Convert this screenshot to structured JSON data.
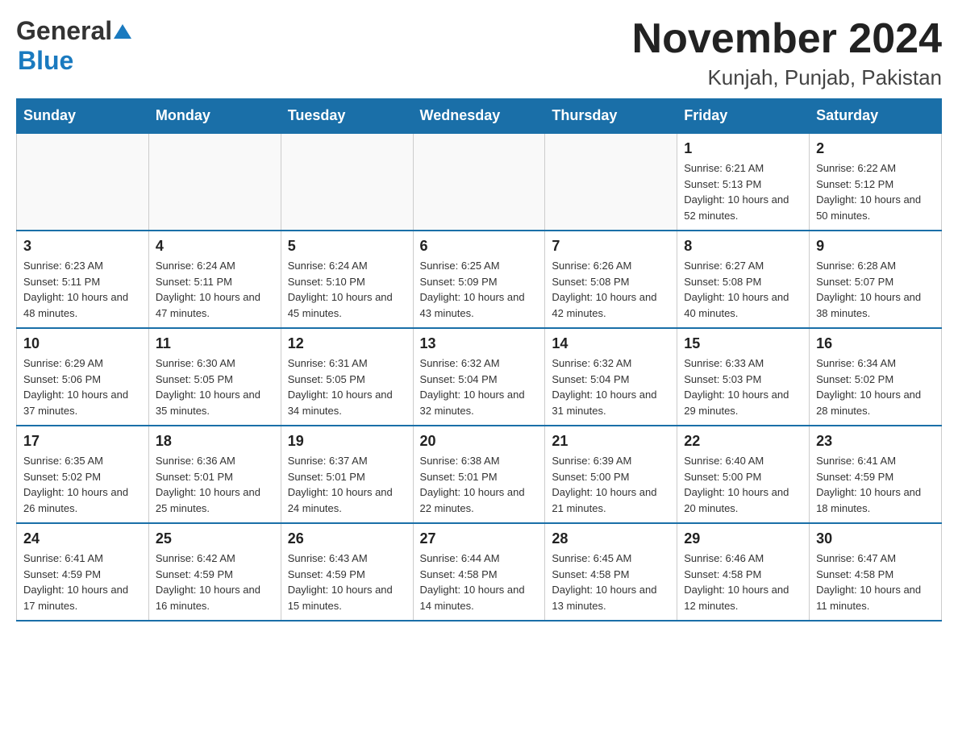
{
  "header": {
    "month_year": "November 2024",
    "location": "Kunjah, Punjab, Pakistan",
    "logo_general": "General",
    "logo_blue": "Blue"
  },
  "weekdays": [
    "Sunday",
    "Monday",
    "Tuesday",
    "Wednesday",
    "Thursday",
    "Friday",
    "Saturday"
  ],
  "weeks": [
    [
      {
        "day": "",
        "info": ""
      },
      {
        "day": "",
        "info": ""
      },
      {
        "day": "",
        "info": ""
      },
      {
        "day": "",
        "info": ""
      },
      {
        "day": "",
        "info": ""
      },
      {
        "day": "1",
        "info": "Sunrise: 6:21 AM\nSunset: 5:13 PM\nDaylight: 10 hours and 52 minutes."
      },
      {
        "day": "2",
        "info": "Sunrise: 6:22 AM\nSunset: 5:12 PM\nDaylight: 10 hours and 50 minutes."
      }
    ],
    [
      {
        "day": "3",
        "info": "Sunrise: 6:23 AM\nSunset: 5:11 PM\nDaylight: 10 hours and 48 minutes."
      },
      {
        "day": "4",
        "info": "Sunrise: 6:24 AM\nSunset: 5:11 PM\nDaylight: 10 hours and 47 minutes."
      },
      {
        "day": "5",
        "info": "Sunrise: 6:24 AM\nSunset: 5:10 PM\nDaylight: 10 hours and 45 minutes."
      },
      {
        "day": "6",
        "info": "Sunrise: 6:25 AM\nSunset: 5:09 PM\nDaylight: 10 hours and 43 minutes."
      },
      {
        "day": "7",
        "info": "Sunrise: 6:26 AM\nSunset: 5:08 PM\nDaylight: 10 hours and 42 minutes."
      },
      {
        "day": "8",
        "info": "Sunrise: 6:27 AM\nSunset: 5:08 PM\nDaylight: 10 hours and 40 minutes."
      },
      {
        "day": "9",
        "info": "Sunrise: 6:28 AM\nSunset: 5:07 PM\nDaylight: 10 hours and 38 minutes."
      }
    ],
    [
      {
        "day": "10",
        "info": "Sunrise: 6:29 AM\nSunset: 5:06 PM\nDaylight: 10 hours and 37 minutes."
      },
      {
        "day": "11",
        "info": "Sunrise: 6:30 AM\nSunset: 5:05 PM\nDaylight: 10 hours and 35 minutes."
      },
      {
        "day": "12",
        "info": "Sunrise: 6:31 AM\nSunset: 5:05 PM\nDaylight: 10 hours and 34 minutes."
      },
      {
        "day": "13",
        "info": "Sunrise: 6:32 AM\nSunset: 5:04 PM\nDaylight: 10 hours and 32 minutes."
      },
      {
        "day": "14",
        "info": "Sunrise: 6:32 AM\nSunset: 5:04 PM\nDaylight: 10 hours and 31 minutes."
      },
      {
        "day": "15",
        "info": "Sunrise: 6:33 AM\nSunset: 5:03 PM\nDaylight: 10 hours and 29 minutes."
      },
      {
        "day": "16",
        "info": "Sunrise: 6:34 AM\nSunset: 5:02 PM\nDaylight: 10 hours and 28 minutes."
      }
    ],
    [
      {
        "day": "17",
        "info": "Sunrise: 6:35 AM\nSunset: 5:02 PM\nDaylight: 10 hours and 26 minutes."
      },
      {
        "day": "18",
        "info": "Sunrise: 6:36 AM\nSunset: 5:01 PM\nDaylight: 10 hours and 25 minutes."
      },
      {
        "day": "19",
        "info": "Sunrise: 6:37 AM\nSunset: 5:01 PM\nDaylight: 10 hours and 24 minutes."
      },
      {
        "day": "20",
        "info": "Sunrise: 6:38 AM\nSunset: 5:01 PM\nDaylight: 10 hours and 22 minutes."
      },
      {
        "day": "21",
        "info": "Sunrise: 6:39 AM\nSunset: 5:00 PM\nDaylight: 10 hours and 21 minutes."
      },
      {
        "day": "22",
        "info": "Sunrise: 6:40 AM\nSunset: 5:00 PM\nDaylight: 10 hours and 20 minutes."
      },
      {
        "day": "23",
        "info": "Sunrise: 6:41 AM\nSunset: 4:59 PM\nDaylight: 10 hours and 18 minutes."
      }
    ],
    [
      {
        "day": "24",
        "info": "Sunrise: 6:41 AM\nSunset: 4:59 PM\nDaylight: 10 hours and 17 minutes."
      },
      {
        "day": "25",
        "info": "Sunrise: 6:42 AM\nSunset: 4:59 PM\nDaylight: 10 hours and 16 minutes."
      },
      {
        "day": "26",
        "info": "Sunrise: 6:43 AM\nSunset: 4:59 PM\nDaylight: 10 hours and 15 minutes."
      },
      {
        "day": "27",
        "info": "Sunrise: 6:44 AM\nSunset: 4:58 PM\nDaylight: 10 hours and 14 minutes."
      },
      {
        "day": "28",
        "info": "Sunrise: 6:45 AM\nSunset: 4:58 PM\nDaylight: 10 hours and 13 minutes."
      },
      {
        "day": "29",
        "info": "Sunrise: 6:46 AM\nSunset: 4:58 PM\nDaylight: 10 hours and 12 minutes."
      },
      {
        "day": "30",
        "info": "Sunrise: 6:47 AM\nSunset: 4:58 PM\nDaylight: 10 hours and 11 minutes."
      }
    ]
  ]
}
